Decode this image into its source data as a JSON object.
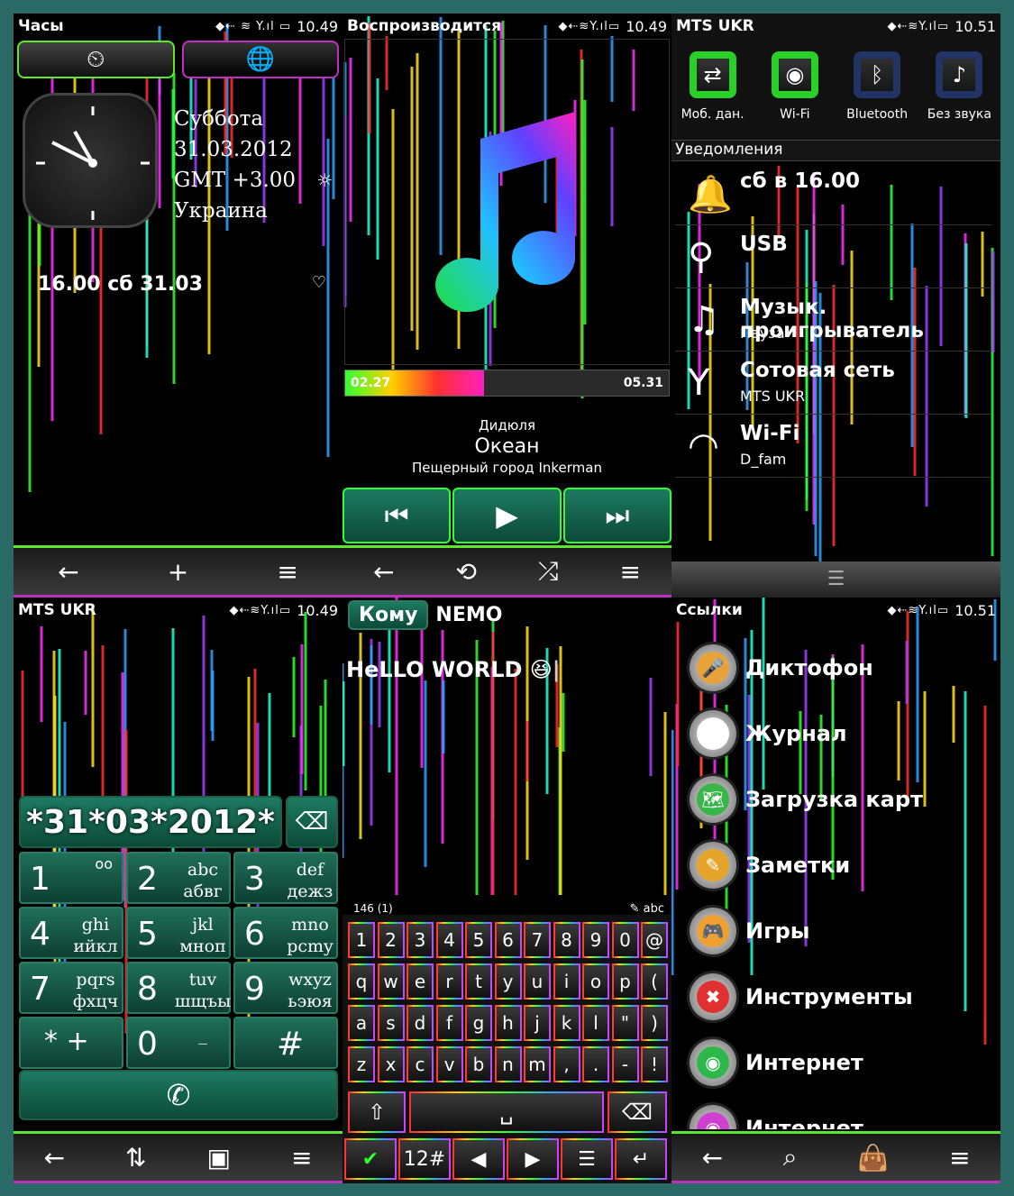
{
  "clock": {
    "status": {
      "title": "Часы",
      "time": "10.49"
    },
    "day": "Суббота",
    "date": "31.03.2012",
    "gmt": "GMT  +3.00",
    "region": "Украина",
    "alarm": "16.00 сб 31.03"
  },
  "player": {
    "status": {
      "title": "Воспроизводится",
      "time": "10.49"
    },
    "elapsed": "02.27",
    "total": "05.31",
    "progress": 0.43,
    "artist": "Дидюля",
    "track": "Океан",
    "album": "Пещерный город Inkerman"
  },
  "notify": {
    "status": {
      "title": "MTS UKR",
      "time": "10.51"
    },
    "toggles": [
      {
        "label": "Моб. дан.",
        "on": true,
        "icon": "⇄"
      },
      {
        "label": "Wi-Fi",
        "on": true,
        "icon": "◉"
      },
      {
        "label": "Bluetooth",
        "on": false,
        "icon": "ᛒ"
      },
      {
        "label": "Без звука",
        "on": false,
        "icon": "♪"
      }
    ],
    "section": "Уведомления",
    "items": [
      {
        "icon": "🔔",
        "title": "сб в 16.00",
        "sub": ""
      },
      {
        "icon": "⚲",
        "title": "USB",
        "sub": ""
      },
      {
        "icon": "♫",
        "title": "Музык. проигрыватель",
        "sub": "Пауза"
      },
      {
        "icon": "Y",
        "title": "Сотовая сеть",
        "sub": "MTS UKR"
      },
      {
        "icon": "◠",
        "title": "Wi-Fi",
        "sub": "D_fam"
      }
    ]
  },
  "dialer": {
    "status": {
      "title": "MTS UKR",
      "time": "10.49"
    },
    "number": "*31*03*2012*",
    "keys": [
      {
        "n": "1",
        "l": "",
        "voicemail": "oo"
      },
      {
        "n": "2",
        "l": "abc\nабвг"
      },
      {
        "n": "3",
        "l": "def\nдежз"
      },
      {
        "n": "4",
        "l": "ghi\nийкл"
      },
      {
        "n": "5",
        "l": "jkl\nмнoп"
      },
      {
        "n": "6",
        "l": "mno\npcmy"
      },
      {
        "n": "7",
        "l": "pqrs\nфхцч"
      },
      {
        "n": "8",
        "l": "tuv\nшщъы"
      },
      {
        "n": "9",
        "l": "wxyz\nьэюя"
      },
      {
        "n": "* +",
        "l": ""
      },
      {
        "n": "0",
        "l": "_"
      },
      {
        "n": "#",
        "l": ""
      }
    ]
  },
  "message": {
    "to_label": "Кому",
    "to_value": "NEMO",
    "body": "HeLLO WORLD 😆",
    "counter": "146 (1)",
    "mode": "abc",
    "rows": [
      [
        "1",
        "2",
        "3",
        "4",
        "5",
        "6",
        "7",
        "8",
        "9",
        "0",
        "@"
      ],
      [
        "q",
        "w",
        "e",
        "r",
        "t",
        "y",
        "u",
        "i",
        "o",
        "p",
        "("
      ],
      [
        "a",
        "s",
        "d",
        "f",
        "g",
        "h",
        "j",
        "k",
        "l",
        "\"",
        ")"
      ],
      [
        "z",
        "x",
        "c",
        "v",
        "b",
        "n",
        "m",
        ",",
        ".",
        "-",
        "!"
      ]
    ],
    "numsym": "12#"
  },
  "links": {
    "status": {
      "title": "Ссылки",
      "time": "10.51"
    },
    "items": [
      {
        "label": "Диктофон",
        "color": "#e8a23a",
        "icon": "🎤"
      },
      {
        "label": "Журнал",
        "color": "#ffffff",
        "icon": "⇅"
      },
      {
        "label": "Загрузка карт",
        "color": "#3ab54a",
        "icon": "🗺"
      },
      {
        "label": "Заметки",
        "color": "#e6a52a",
        "icon": "✎"
      },
      {
        "label": "Игры",
        "color": "#f0a030",
        "icon": "🎮"
      },
      {
        "label": "Инструменты",
        "color": "#e03030",
        "icon": "✖"
      },
      {
        "label": "Интернет",
        "color": "#2eb84a",
        "icon": "◉"
      },
      {
        "label": "Интернет",
        "color": "#d040d0",
        "icon": "◉"
      }
    ]
  }
}
